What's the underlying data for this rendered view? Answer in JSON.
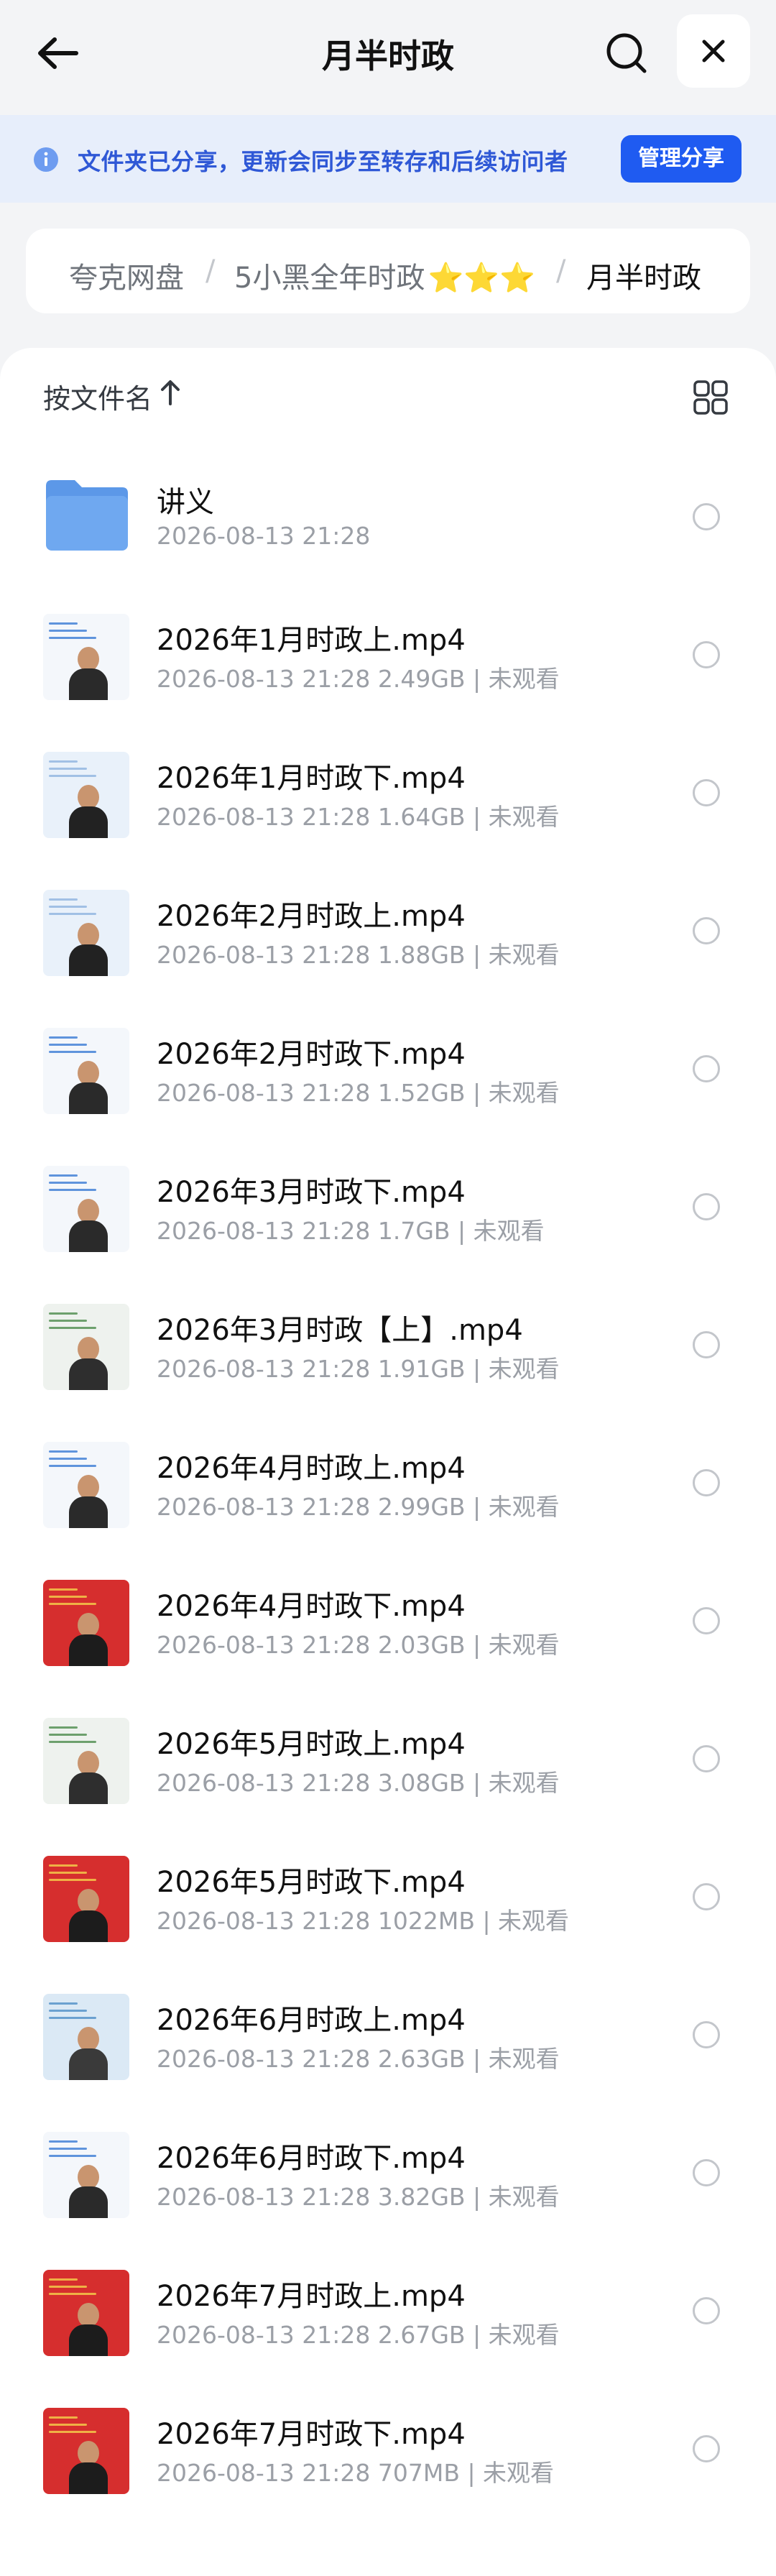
{
  "header": {
    "title": "月半时政"
  },
  "notice": {
    "text": "文件夹已分享，更新会同步至转存和后续访问者",
    "button": "管理分享"
  },
  "breadcrumb": {
    "root": "夸克网盘",
    "sep": "/",
    "middle": "5小黑全年时政",
    "middle_stars": "⭐⭐⭐",
    "current": "月半时政"
  },
  "toolbar": {
    "sort_label": "按文件名"
  },
  "files": [
    {
      "name": "讲义",
      "meta": "2026-08-13 21:28",
      "type": "folder"
    },
    {
      "name": "2026年1月时政上.mp4",
      "meta": "2026-08-13 21:28  2.49GB | 未观看",
      "type": "video",
      "thumb": "whiteboard"
    },
    {
      "name": "2026年1月时政下.mp4",
      "meta": "2026-08-13 21:28  1.64GB | 未观看",
      "type": "video",
      "thumb": "light"
    },
    {
      "name": "2026年2月时政上.mp4",
      "meta": "2026-08-13 21:28  1.88GB | 未观看",
      "type": "video",
      "thumb": "light"
    },
    {
      "name": "2026年2月时政下.mp4",
      "meta": "2026-08-13 21:28  1.52GB | 未观看",
      "type": "video",
      "thumb": "whiteboard"
    },
    {
      "name": "2026年3月时政下.mp4",
      "meta": "2026-08-13 21:28  1.7GB | 未观看",
      "type": "video",
      "thumb": "whiteboard"
    },
    {
      "name": "2026年3月时政【上】.mp4",
      "meta": "2026-08-13 21:28  1.91GB | 未观看",
      "type": "video",
      "thumb": "table"
    },
    {
      "name": "2026年4月时政上.mp4",
      "meta": "2026-08-13 21:28  2.99GB | 未观看",
      "type": "video",
      "thumb": "whiteboard"
    },
    {
      "name": "2026年4月时政下.mp4",
      "meta": "2026-08-13 21:28  2.03GB | 未观看",
      "type": "video",
      "thumb": "red"
    },
    {
      "name": "2026年5月时政上.mp4",
      "meta": "2026-08-13 21:28  3.08GB | 未观看",
      "type": "video",
      "thumb": "table"
    },
    {
      "name": "2026年5月时政下.mp4",
      "meta": "2026-08-13 21:28  1022MB | 未观看",
      "type": "video",
      "thumb": "red"
    },
    {
      "name": "2026年6月时政上.mp4",
      "meta": "2026-08-13 21:28  2.63GB | 未观看",
      "type": "video",
      "thumb": "map"
    },
    {
      "name": "2026年6月时政下.mp4",
      "meta": "2026-08-13 21:28  3.82GB | 未观看",
      "type": "video",
      "thumb": "whiteboard"
    },
    {
      "name": "2026年7月时政上.mp4",
      "meta": "2026-08-13 21:28  2.67GB | 未观看",
      "type": "video",
      "thumb": "red"
    },
    {
      "name": "2026年7月时政下.mp4",
      "meta": "2026-08-13 21:28  707MB | 未观看",
      "type": "video",
      "thumb": "red"
    }
  ],
  "colors": {
    "accent": "#1f5bf1",
    "notice_text": "#2f58d6",
    "folder": "#6fa8f0"
  }
}
